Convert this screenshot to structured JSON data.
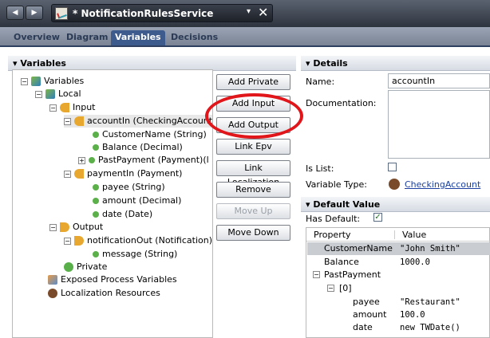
{
  "titlebar": {
    "doc_title": "* NotificationRulesService",
    "dropdown": "▾",
    "close": "✕",
    "back": "◀",
    "forward": "▶"
  },
  "tabs": [
    "Overview",
    "Diagram",
    "Variables",
    "Decisions"
  ],
  "variables_panel": {
    "title": "Variables",
    "tree": [
      {
        "label": "Variables"
      },
      {
        "label": "Local"
      },
      {
        "label": "Input"
      },
      {
        "label": "accountIn (CheckingAccount)"
      },
      {
        "label": "CustomerName (String)"
      },
      {
        "label": "Balance (Decimal)"
      },
      {
        "label": "PastPayment (Payment)(l"
      },
      {
        "label": "paymentIn (Payment)"
      },
      {
        "label": "payee (String)"
      },
      {
        "label": "amount (Decimal)"
      },
      {
        "label": "date (Date)"
      },
      {
        "label": "Output"
      },
      {
        "label": "notificationOut (Notification)"
      },
      {
        "label": "message (String)"
      },
      {
        "label": "Private"
      },
      {
        "label": "Exposed Process Variables"
      },
      {
        "label": "Localization Resources"
      }
    ]
  },
  "buttons": {
    "add_private": "Add Private",
    "add_input": "Add Input",
    "add_output": "Add Output",
    "link_epv": "Link Epv",
    "link_localization": "Link Localization",
    "remove": "Remove",
    "move_up": "Move Up",
    "move_down": "Move Down"
  },
  "details": {
    "title": "Details",
    "name_label": "Name:",
    "name_value": "accountIn",
    "documentation_label": "Documentation:",
    "is_list_label": "Is List:",
    "variable_type_label": "Variable Type:",
    "variable_type_value": "CheckingAccount"
  },
  "default_value": {
    "title": "Default Value",
    "has_default_label": "Has Default:",
    "col_property": "Property",
    "col_value": "Value",
    "rows": [
      {
        "property": "CustomerName",
        "value": "\"John Smith\""
      },
      {
        "property": "Balance",
        "value": "1000.0"
      },
      {
        "property": "PastPayment",
        "value": ""
      },
      {
        "property": "[0]",
        "value": ""
      },
      {
        "property": "payee",
        "value": "\"Restaurant\""
      },
      {
        "property": "amount",
        "value": "100.0"
      },
      {
        "property": "date",
        "value": "new TWDate()"
      }
    ]
  }
}
